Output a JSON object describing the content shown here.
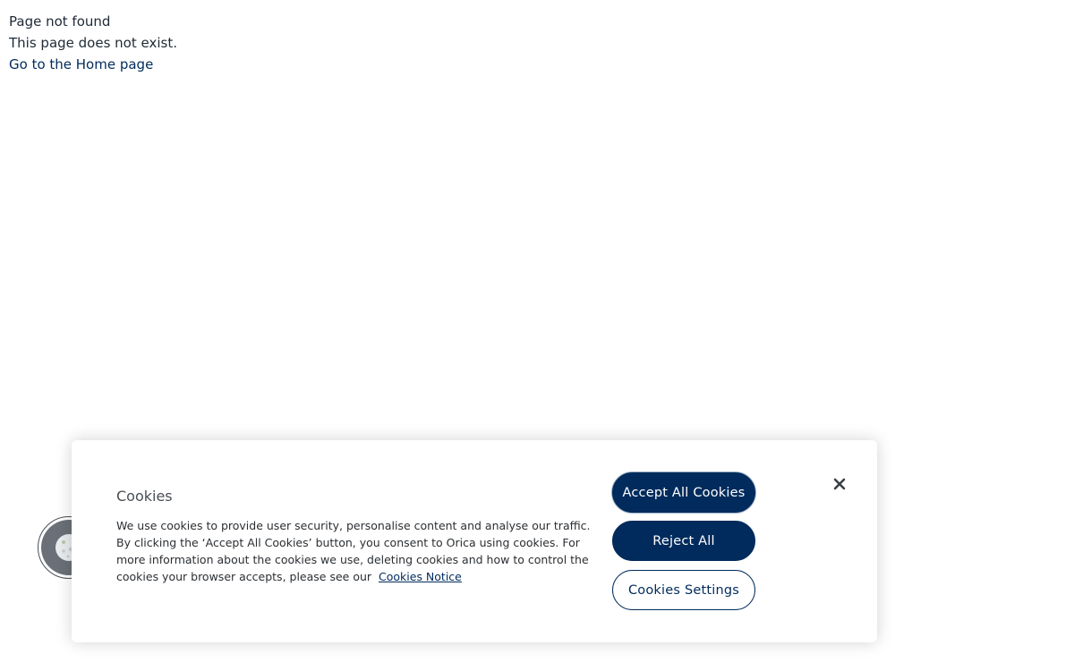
{
  "not_found": {
    "heading": "Page not found",
    "message": "This page does not exist.",
    "home_link": "Go to the Home page"
  },
  "cookie_banner": {
    "title": "Cookies",
    "body": "We use cookies to provide user security, personalise content and analyse our traffic. By clicking the ‘Accept All Cookies’ button, you consent to Orica using cookies. For more information about the cookies we use, deleting cookies and how to control the cookies your browser accepts, please see our",
    "notice_link": "Cookies Notice",
    "accept_label": "Accept All Cookies",
    "reject_label": "Reject All",
    "settings_label": "Cookies Settings",
    "close_icon": "close-icon"
  },
  "cookie_fab": {
    "icon": "cookie-icon"
  },
  "colors": {
    "brand": "#002b5c",
    "text": "#1f2a36",
    "panel_bg": "#ffffff"
  }
}
